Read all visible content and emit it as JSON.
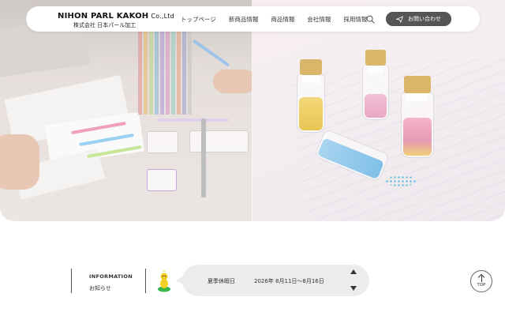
{
  "header": {
    "logo_en": "NIHON PARL KAKOH",
    "logo_en_suffix": "Co.,Ltd",
    "logo_jp": "株式会社 日本パール加工",
    "nav": [
      "トップページ",
      "新商品情報",
      "商品情報",
      "会社情報",
      "採用情報"
    ],
    "search_icon": "search-icon",
    "contact_label": "お問い合わせ",
    "contact_icon": "paper-plane-icon"
  },
  "news": {
    "heading_en": "INFORMATION",
    "heading_jp": "お知らせ",
    "mascot": "duck-mascot-icon",
    "item_title": "夏季休暇日",
    "item_date": "2026年 8月11日～8月16日",
    "up_icon": "arrow-up-icon",
    "down_icon": "arrow-down-icon"
  },
  "top_button": {
    "label": "TOP",
    "icon": "arrow-up-icon"
  },
  "colors": {
    "contact_bg": "#555555",
    "news_bg": "#ececec",
    "cap_gold": "#d9b66a"
  }
}
